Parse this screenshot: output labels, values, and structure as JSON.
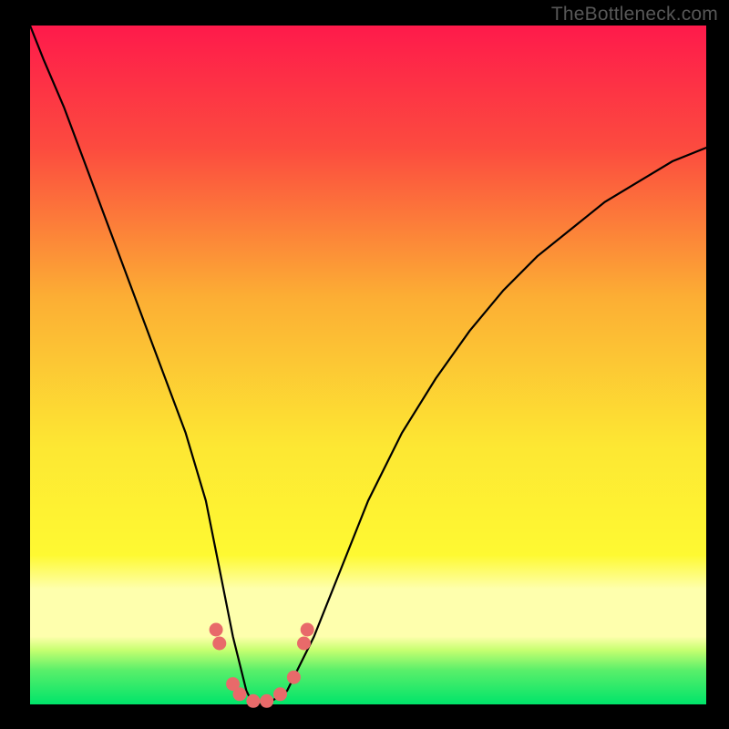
{
  "watermark": "TheBottleneck.com",
  "chart_data": {
    "type": "line",
    "title": "",
    "xlabel": "",
    "ylabel": "",
    "xlim": [
      0,
      100
    ],
    "ylim": [
      0,
      100
    ],
    "grid": false,
    "legend": false,
    "background_gradient": {
      "top_color": "#fe1a4b",
      "mid_color_1": "#fcae34",
      "mid_color_2": "#fef932",
      "band_color": "#feffad",
      "bottom_color": "#00e46a"
    },
    "series": [
      {
        "name": "curve",
        "x": [
          0,
          2,
          5,
          8,
          11,
          14,
          17,
          20,
          23,
          26,
          28,
          30,
          32,
          33,
          35,
          38,
          42,
          46,
          50,
          55,
          60,
          65,
          70,
          75,
          80,
          85,
          90,
          95,
          100
        ],
        "y": [
          100,
          95,
          88,
          80,
          72,
          64,
          56,
          48,
          40,
          30,
          20,
          10,
          2,
          0,
          0,
          2,
          10,
          20,
          30,
          40,
          48,
          55,
          61,
          66,
          70,
          74,
          77,
          80,
          82
        ]
      }
    ],
    "markers": {
      "name": "highlight-dots",
      "color": "#e86a6a",
      "points": [
        {
          "x": 27.5,
          "y": 11
        },
        {
          "x": 28.0,
          "y": 9
        },
        {
          "x": 30.0,
          "y": 3
        },
        {
          "x": 31.0,
          "y": 1.5
        },
        {
          "x": 33.0,
          "y": 0.5
        },
        {
          "x": 35.0,
          "y": 0.5
        },
        {
          "x": 37.0,
          "y": 1.5
        },
        {
          "x": 39.0,
          "y": 4
        },
        {
          "x": 40.5,
          "y": 9
        },
        {
          "x": 41.0,
          "y": 11
        }
      ]
    }
  }
}
